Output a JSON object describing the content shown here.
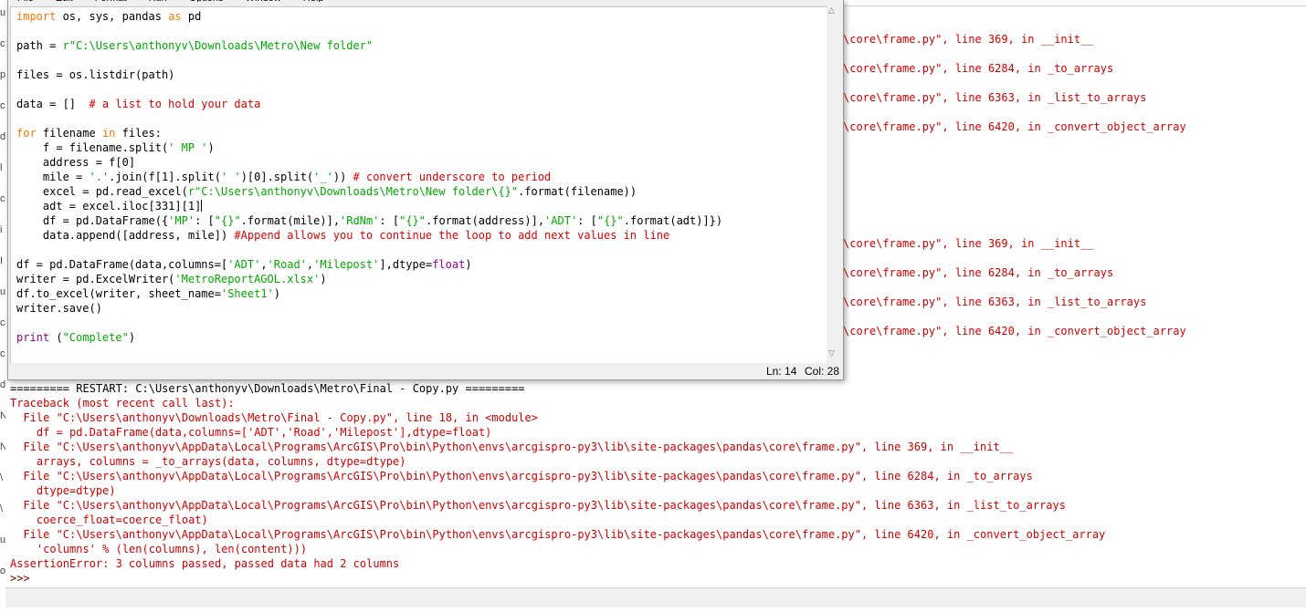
{
  "menu": {
    "items": [
      "File",
      "Edit",
      "Format",
      "Run",
      "Options",
      "Window",
      "Help"
    ]
  },
  "editor": {
    "status": {
      "ln": "Ln: 14",
      "col": "Col: 28"
    },
    "lines": [
      [
        [
          "kw",
          "import"
        ],
        [
          "tx",
          " os, sys, pandas "
        ],
        [
          "kw",
          "as"
        ],
        [
          "tx",
          " pd"
        ]
      ],
      [],
      [
        [
          "tx",
          "path = "
        ],
        [
          "st",
          "r\"C:\\Users\\anthonyv\\Downloads\\Metro\\New folder\""
        ]
      ],
      [],
      [
        [
          "tx",
          "files = os.listdir(path)"
        ]
      ],
      [],
      [
        [
          "tx",
          "data = []  "
        ],
        [
          "cm",
          "# a list to hold your data"
        ]
      ],
      [],
      [
        [
          "kw",
          "for"
        ],
        [
          "tx",
          " filename "
        ],
        [
          "kw",
          "in"
        ],
        [
          "tx",
          " files:"
        ]
      ],
      [
        [
          "tx",
          "    f = filename.split("
        ],
        [
          "st",
          "' MP '"
        ],
        [
          "tx",
          ")"
        ]
      ],
      [
        [
          "tx",
          "    address = f[0]"
        ]
      ],
      [
        [
          "tx",
          "    mile = "
        ],
        [
          "st",
          "'.'"
        ],
        [
          "tx",
          ".join(f[1].split("
        ],
        [
          "st",
          "' '"
        ],
        [
          "tx",
          ")[0].split("
        ],
        [
          "st",
          "'_'"
        ],
        [
          "tx",
          "))"
        ],
        [
          "cm",
          " # convert underscore to period"
        ]
      ],
      [
        [
          "tx",
          "    excel = pd.read_excel("
        ],
        [
          "st",
          "r\"C:\\Users\\anthonyv\\Downloads\\Metro\\New folder\\{}\""
        ],
        [
          "tx",
          ".format(filename))"
        ]
      ],
      [
        [
          "tx",
          "    adt = excel.iloc[331][1]"
        ],
        [
          "cur",
          ""
        ]
      ],
      [
        [
          "tx",
          "    df = pd.DataFrame({"
        ],
        [
          "st",
          "'MP'"
        ],
        [
          "tx",
          ": ["
        ],
        [
          "st",
          "\"{}\""
        ],
        [
          "tx",
          ".format(mile)],"
        ],
        [
          "st",
          "'RdNm'"
        ],
        [
          "tx",
          ": ["
        ],
        [
          "st",
          "\"{}\""
        ],
        [
          "tx",
          ".format(address)],"
        ],
        [
          "st",
          "'ADT'"
        ],
        [
          "tx",
          ": ["
        ],
        [
          "st",
          "\"{}\""
        ],
        [
          "tx",
          ".format(adt)]})"
        ]
      ],
      [
        [
          "tx",
          "    data.append([address, mile]) "
        ],
        [
          "cm",
          "#Append allows you to continue the loop to add next values in line"
        ]
      ],
      [],
      [
        [
          "tx",
          "df = pd.DataFrame(data,columns=["
        ],
        [
          "st",
          "'ADT'"
        ],
        [
          "tx",
          ","
        ],
        [
          "st",
          "'Road'"
        ],
        [
          "tx",
          ","
        ],
        [
          "st",
          "'Milepost'"
        ],
        [
          "tx",
          "],dtype="
        ],
        [
          "bi",
          "float"
        ],
        [
          "tx",
          ")"
        ]
      ],
      [
        [
          "tx",
          "writer = pd.ExcelWriter("
        ],
        [
          "st",
          "'MetroReportAGOL.xlsx'"
        ],
        [
          "tx",
          ")"
        ]
      ],
      [
        [
          "tx",
          "df.to_excel(writer, sheet_name="
        ],
        [
          "st",
          "'Sheet1'"
        ],
        [
          "tx",
          ")"
        ]
      ],
      [
        [
          "tx",
          "writer.save()"
        ]
      ],
      [],
      [
        [
          "bi",
          "print"
        ],
        [
          "tx",
          " ("
        ],
        [
          "st",
          "\"Complete\""
        ],
        [
          "tx",
          ")"
        ]
      ]
    ]
  },
  "shell_background": {
    "upper": [
      "\\core\\frame.py\", line 369, in __init__",
      "\\core\\frame.py\", line 6284, in _to_arrays",
      "\\core\\frame.py\", line 6363, in _list_to_arrays",
      "\\core\\frame.py\", line 6420, in _convert_object_array"
    ],
    "lower": [
      "\\core\\frame.py\", line 369, in __init__",
      "\\core\\frame.py\", line 6284, in _to_arrays",
      "\\core\\frame.py\", line 6363, in _list_to_arrays",
      "\\core\\frame.py\", line 6420, in _convert_object_array"
    ]
  },
  "left_fragments": [
    "u",
    "c",
    "p",
    "c",
    "d",
    "l",
    "c",
    "i",
    "I",
    "u",
    "c",
    "c",
    "d",
    "N",
    "N",
    "\\",
    "\\",
    "u",
    "o"
  ],
  "shell_output": [
    {
      "type": "restart",
      "text": "========= RESTART: C:\\Users\\anthonyv\\Downloads\\Metro\\Final - Copy.py ========="
    },
    {
      "type": "err",
      "text": "Traceback (most recent call last):"
    },
    {
      "type": "err",
      "text": "  File \"C:\\Users\\anthonyv\\Downloads\\Metro\\Final - Copy.py\", line 18, in <module>"
    },
    {
      "type": "err",
      "text": "    df = pd.DataFrame(data,columns=['ADT','Road','Milepost'],dtype=float)"
    },
    {
      "type": "err",
      "text": "  File \"C:\\Users\\anthonyv\\AppData\\Local\\Programs\\ArcGIS\\Pro\\bin\\Python\\envs\\arcgispro-py3\\lib\\site-packages\\pandas\\core\\frame.py\", line 369, in __init__"
    },
    {
      "type": "err",
      "text": "    arrays, columns = _to_arrays(data, columns, dtype=dtype)"
    },
    {
      "type": "err",
      "text": "  File \"C:\\Users\\anthonyv\\AppData\\Local\\Programs\\ArcGIS\\Pro\\bin\\Python\\envs\\arcgispro-py3\\lib\\site-packages\\pandas\\core\\frame.py\", line 6284, in _to_arrays"
    },
    {
      "type": "err",
      "text": "    dtype=dtype)"
    },
    {
      "type": "err",
      "text": "  File \"C:\\Users\\anthonyv\\AppData\\Local\\Programs\\ArcGIS\\Pro\\bin\\Python\\envs\\arcgispro-py3\\lib\\site-packages\\pandas\\core\\frame.py\", line 6363, in _list_to_arrays"
    },
    {
      "type": "err",
      "text": "    coerce_float=coerce_float)"
    },
    {
      "type": "err",
      "text": "  File \"C:\\Users\\anthonyv\\AppData\\Local\\Programs\\ArcGIS\\Pro\\bin\\Python\\envs\\arcgispro-py3\\lib\\site-packages\\pandas\\core\\frame.py\", line 6420, in _convert_object_array"
    },
    {
      "type": "err",
      "text": "    'columns' % (len(columns), len(content)))"
    },
    {
      "type": "err",
      "text": "AssertionError: 3 columns passed, passed data had 2 columns"
    },
    {
      "type": "prompt",
      "text": ">>> "
    }
  ]
}
